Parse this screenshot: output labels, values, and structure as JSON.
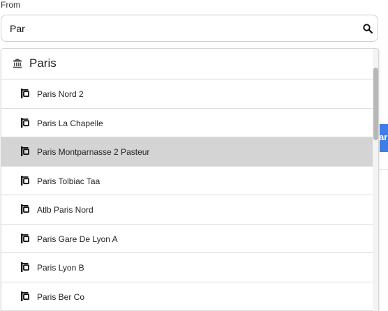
{
  "from_field": {
    "label": "From",
    "value": "Par",
    "search_icon": "search-icon"
  },
  "dropdown": {
    "city": {
      "icon": "bank-icon",
      "label": "Paris"
    },
    "stations": [
      {
        "icon": "bus-stop-icon",
        "label": "Paris Nord 2"
      },
      {
        "icon": "bus-stop-icon",
        "label": "Paris La Chapelle"
      },
      {
        "icon": "bus-stop-icon",
        "label": "Paris Montparnasse 2 Pasteur",
        "highlighted": true
      },
      {
        "icon": "bus-stop-icon",
        "label": "Paris Tolbiac Taa"
      },
      {
        "icon": "bus-stop-icon",
        "label": "Atlb Paris Nord"
      },
      {
        "icon": "bus-stop-icon",
        "label": "Paris Gare De Lyon A"
      },
      {
        "icon": "bus-stop-icon",
        "label": "Paris Lyon B"
      },
      {
        "icon": "bus-stop-icon",
        "label": "Paris Ber Co"
      }
    ]
  },
  "background_button": {
    "label": "ar",
    "color": "#3f7ee8"
  },
  "colors": {
    "highlight": "#d4d4d4",
    "border": "#d9d9d9",
    "scrollbar_thumb": "#b8b8b8"
  }
}
